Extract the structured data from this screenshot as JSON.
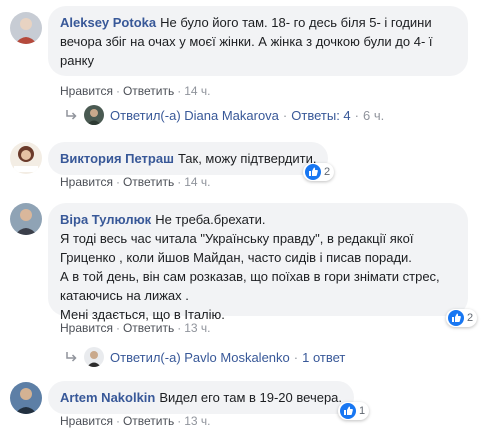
{
  "comments": [
    {
      "author": "Aleksey Potoka",
      "text": "Не було його там. 18- го десь біля 5- і години вечора збіг на очах у моєї жінки. А жінка з дочкою були до 4- ї ранку",
      "like_label": "Нравится",
      "reply_label": "Ответить",
      "time": "14 ч.",
      "reactions_count": "",
      "reply_summary": {
        "text": "Ответил(-а) Diana Makarova",
        "replies": "Ответы: 4",
        "time": "6 ч."
      }
    },
    {
      "author": "Виктория Петраш",
      "text": "Так, можу підтвердити.",
      "like_label": "Нравится",
      "reply_label": "Ответить",
      "time": "14 ч.",
      "reactions_count": "2"
    },
    {
      "author": "Віра Тулюлюк",
      "text_lines": [
        "Не треба.брехати.",
        "Я тоді весь час читала \"Українську правду\", в редакції якої Гриценко , коли йшов Майдан, часто сидів і писав поради.",
        "А в той день, він сам розказав, що поїхав в гори знімати стрес, катаючись на лижах .",
        "Мені здається, що в Італію."
      ],
      "like_label": "Нравится",
      "reply_label": "Ответить",
      "time": "13 ч.",
      "reactions_count": "2",
      "reply_summary": {
        "text": "Ответил(-а) Pavlo Moskalenko",
        "replies": "1 ответ",
        "time": ""
      }
    },
    {
      "author": "Artem Nakolkin",
      "text": "Видел его там в 19-20 вечера.",
      "like_label": "Нравится",
      "reply_label": "Ответить",
      "time": "13 ч.",
      "reactions_count": "1"
    }
  ],
  "sep": "·",
  "colors": {
    "link": "#385898",
    "bubble": "#f2f3f5",
    "like": "#1877f2",
    "meta": "#90949c"
  }
}
